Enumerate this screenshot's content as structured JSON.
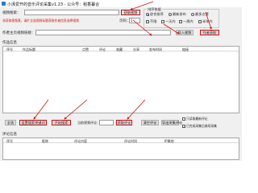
{
  "window": {
    "title": "小湃爱开的音乐评论采集v1.23 - 公众号：稻香暮合"
  },
  "form": {
    "video_keyword_label": "视频搜索：",
    "video_keyword_value": "",
    "fetch_video_button": "获取视频",
    "notice": "非获取视频意，请扩全选视频标题获取作者信息选择视频",
    "page_label": "页码：",
    "page_value": "1",
    "author_profile_label": "作者主页视频链接：",
    "author_profile_value": "",
    "import_button": "导入视频",
    "author_fetch_button": "作者获取"
  },
  "sort": {
    "title": "排序依据",
    "options": [
      {
        "label": "综合排序",
        "selected": true
      },
      {
        "label": "最新发布",
        "selected": false
      },
      {
        "label": "最多点赞",
        "selected": false
      }
    ],
    "time_options": [
      {
        "label": "不限",
        "checked": false
      },
      {
        "label": "一天内",
        "checked": false
      },
      {
        "label": "一周内",
        "checked": false
      },
      {
        "label": "半年内",
        "checked": false
      }
    ]
  },
  "works": {
    "section_label": "作品信息",
    "columns": [
      "序号",
      "作品标题",
      "点赞",
      "评论",
      "收藏",
      "分享",
      "发布时间",
      "链接"
    ]
  },
  "toolbar": {
    "select_all_button": "全选",
    "set_keyword_button": "设置搜索关键词",
    "start_search_button": "开始搜索",
    "collect_count_label": "当前视频评论：",
    "collect_count_value": "",
    "fetch_comments_button": "获取评论",
    "clear_button": "清空评论",
    "export_button": "导出采集评论",
    "auto_sort_label": "只读取最新评论",
    "auto_sort_checked": false,
    "keep_checked_label": "已完成采集后继续采集",
    "keep_checked_checked": true
  },
  "comments": {
    "section_label": "评论信息",
    "columns": [
      "序号",
      "昵称",
      "评论内容",
      "评论时间",
      "IP属地"
    ]
  },
  "colors": {
    "accent": "#d01010",
    "window_bg": "#f0f0f0"
  }
}
